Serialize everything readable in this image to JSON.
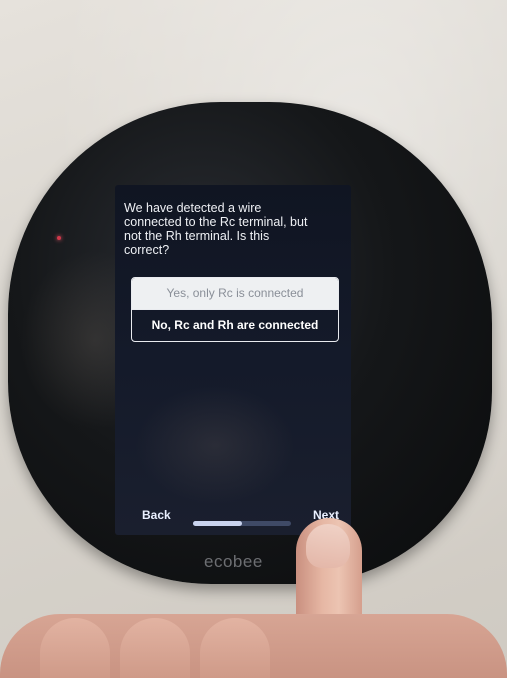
{
  "screen": {
    "question": "We have detected a wire\nconnected to the Rc terminal, but\nnot the Rh terminal.  Is this\ncorrect?",
    "options": [
      {
        "label": "Yes, only Rc is connected",
        "selected": true
      },
      {
        "label": "No, Rc and Rh are connected",
        "selected": false
      }
    ],
    "nav": {
      "back_label": "Back",
      "next_label": "Next"
    },
    "progress_fraction": 0.5
  },
  "device": {
    "brand": "ecobee"
  },
  "colors": {
    "screen_bg": "#141a2a",
    "text": "#eef0f4",
    "selected_option_bg": "#eef0f2",
    "progress_track": "#3f4a66",
    "progress_fill": "#c9d3ee"
  }
}
